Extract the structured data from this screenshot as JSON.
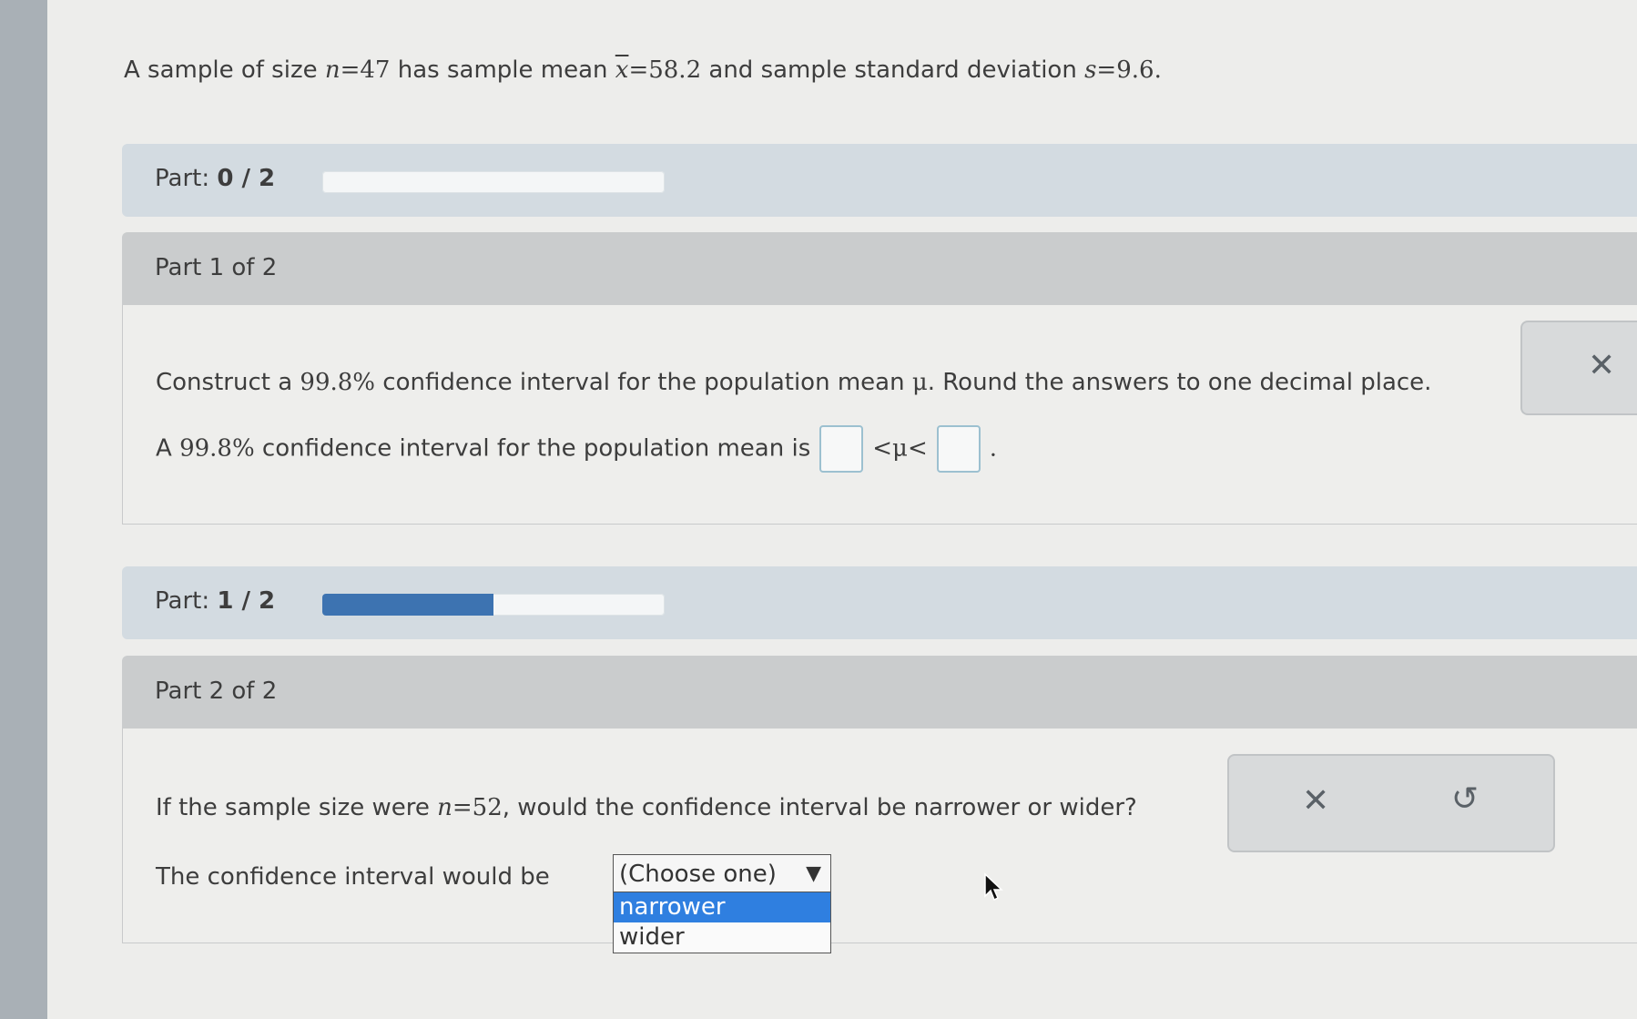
{
  "problem": {
    "prefix": "A sample of size ",
    "n_var": "n",
    "n_eq": "=47",
    "mid1": " has sample mean ",
    "xbar_var": "x",
    "xbar_eq": "=58.2",
    "mid2": " and sample standard deviation ",
    "s_var": "s",
    "s_eq": "=9.6",
    "end": "."
  },
  "status1": {
    "label": "Part: ",
    "value": "0 / 2",
    "progress": 0.0
  },
  "part1": {
    "header": "Part 1 of 2",
    "q_prefix": "Construct a ",
    "q_level": "99.8%",
    "q_mid": " confidence interval for the population mean ",
    "q_mu": "μ",
    "q_end": ". Round the answers to one decimal place.",
    "a_prefix": "A ",
    "a_level": "99.8%",
    "a_mid": " confidence interval for the population mean is",
    "a_ineq": "<μ<",
    "a_end": "."
  },
  "status2": {
    "label": "Part: ",
    "value": "1 / 2",
    "progress": 0.5
  },
  "part2": {
    "header": "Part 2 of 2",
    "q_prefix": "If the sample size were ",
    "q_var": "n",
    "q_eq": "=52",
    "q_end": ", would the confidence interval be narrower or wider?",
    "a_prefix": "The confidence interval would be",
    "select_value": "(Choose one)",
    "caret": "▼",
    "options": [
      "narrower",
      "wider"
    ]
  },
  "tools": {
    "close": "✕",
    "undo": "↺"
  },
  "colors": {
    "accent": "#3d73b1",
    "option_selected": "#2f7fe0"
  }
}
